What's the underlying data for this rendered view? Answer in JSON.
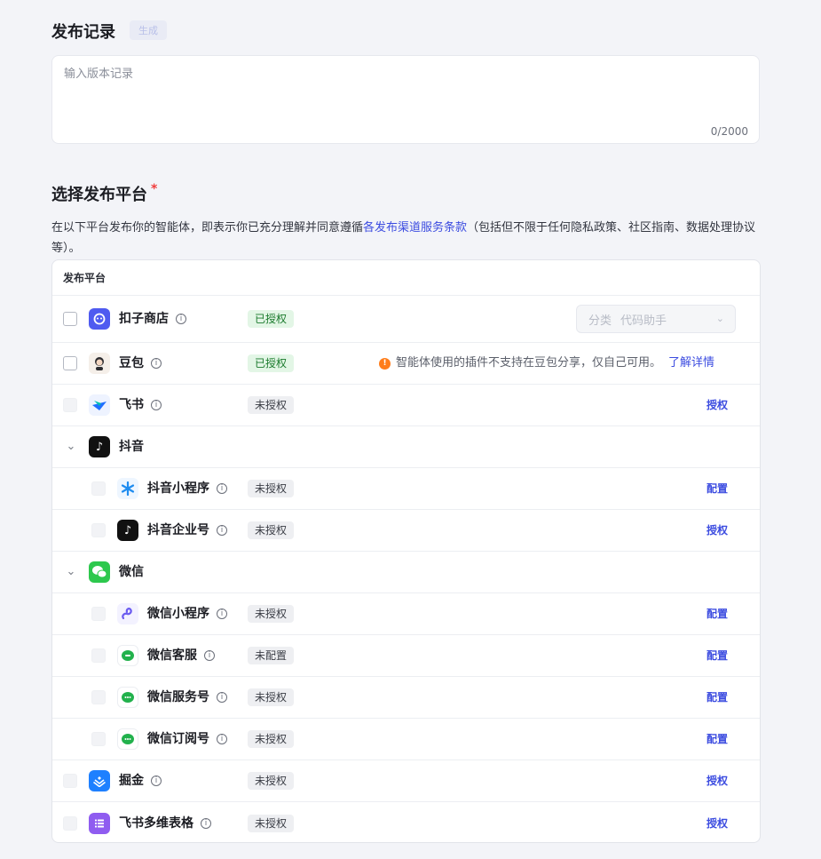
{
  "release_notes": {
    "title": "发布记录",
    "generate_label": "生成",
    "placeholder": "输入版本记录",
    "counter": "0/2000"
  },
  "platforms_section": {
    "title": "选择发布平台",
    "required_mark": "*",
    "desc_before": "在以下平台发布你的智能体，即表示你已充分理解并同意遵循",
    "desc_link": "各发布渠道服务条款",
    "desc_after": "（包括但不限于任何隐私政策、社区指南、数据处理协议等）。",
    "table_header": "发布平台"
  },
  "rows": {
    "kouzi": {
      "name": "扣子商店",
      "status": "已授权",
      "select_label": "分类",
      "select_value": "代码助手"
    },
    "doubao": {
      "name": "豆包",
      "status": "已授权",
      "warning": "智能体使用的插件不支持在豆包分享，仅自己可用。",
      "warning_link": "了解详情"
    },
    "feishu": {
      "name": "飞书",
      "status": "未授权",
      "action": "授权"
    },
    "douyin": {
      "name": "抖音"
    },
    "douyin_mini": {
      "name": "抖音小程序",
      "status": "未授权",
      "action": "配置"
    },
    "douyin_biz": {
      "name": "抖音企业号",
      "status": "未授权",
      "action": "授权"
    },
    "wechat": {
      "name": "微信"
    },
    "wechat_mini": {
      "name": "微信小程序",
      "status": "未授权",
      "action": "配置"
    },
    "wechat_cs": {
      "name": "微信客服",
      "status": "未配置",
      "action": "配置"
    },
    "wechat_service": {
      "name": "微信服务号",
      "status": "未授权",
      "action": "配置"
    },
    "wechat_sub": {
      "name": "微信订阅号",
      "status": "未授权",
      "action": "配置"
    },
    "juejin": {
      "name": "掘金",
      "status": "未授权",
      "action": "授权"
    },
    "feishu_base": {
      "name": "飞书多维表格",
      "status": "未授权",
      "action": "授权"
    }
  },
  "colors": {
    "accent": "#3c4ce0",
    "authorized_bg": "#e3f6e6",
    "warning": "#ff7d1a"
  }
}
